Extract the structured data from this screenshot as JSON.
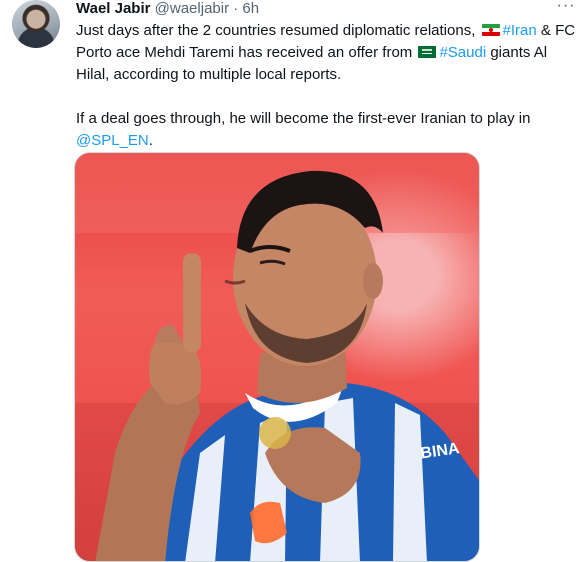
{
  "tweet": {
    "author_name": "Wael Jabir",
    "author_handle": "@waeljabir",
    "separator": "·",
    "time": "6h",
    "more_label": "···",
    "para1": {
      "t1": "Just days after the 2 countries resumed diplomatic relations, ",
      "hashtag1": "#Iran",
      "t2": " & FC Porto ace Mehdi Taremi has received an offer from ",
      "hashtag2": "#Saudi",
      "t3": " giants Al Hilal, according to multiple local reports."
    },
    "para2": {
      "t1": "If a deal goes through, he will become the first-ever Iranian to play in ",
      "mention": "@SPL_EN",
      "t2": "."
    },
    "jersey_text": "BINA",
    "colors": {
      "link": "#1d9bf0",
      "text": "#0f1419",
      "muted": "#536471",
      "background_red": "#e8413f",
      "jersey_blue": "#1f5fb8"
    }
  }
}
